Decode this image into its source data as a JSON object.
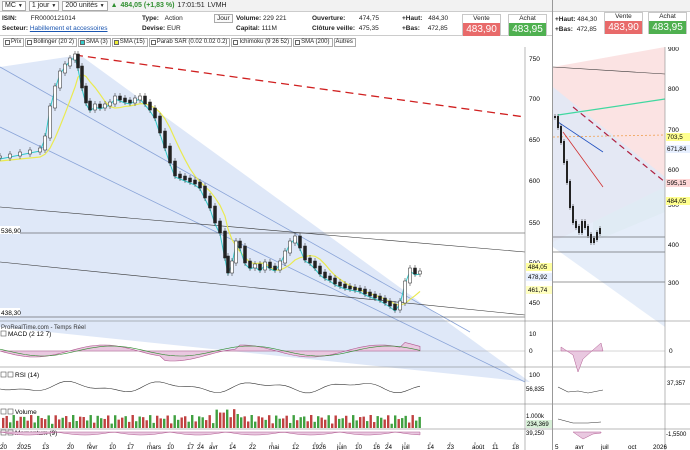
{
  "topbar": {
    "symbol": "MC",
    "period": "1 jour",
    "units": "200 unités",
    "quote": "484,05 (+1,83 %)",
    "time": "17:01:51",
    "name": "LVMH"
  },
  "info": {
    "isin_label": "ISIN:",
    "isin": "FR0000121014",
    "sector_label": "Secteur:",
    "sector": "Habillement et accessoires",
    "type_label": "Type:",
    "type": "Action",
    "currency_label": "Devise:",
    "currency": "EUR",
    "jour_button": "Jour",
    "volume_label": "Volume:",
    "volume": "229 221",
    "capital_label": "Capital:",
    "capital": "111M",
    "open_label": "Ouverture:",
    "open": "474,75",
    "prevclose_label": "Clôture veille:",
    "prevclose": "475,35",
    "high_label": "+Haut:",
    "high": "484,30",
    "low_label": "+Bas:",
    "low": "472,85"
  },
  "quotes": {
    "sell_label": "Vente",
    "sell": "483,90",
    "buy_label": "Achat",
    "buy": "483,95"
  },
  "toolbar": {
    "items": [
      {
        "label": "Prix"
      },
      {
        "label": "Bollinger (20 2)"
      },
      {
        "label": "SMA (3)"
      },
      {
        "label": "SMA (15)"
      },
      {
        "label": "Parab SAR (0.02 0.02 0.2)"
      },
      {
        "label": "Ichimoku (9 26 52)"
      },
      {
        "label": "SMA (200)"
      },
      {
        "label": "Autres"
      }
    ]
  },
  "main_chart": {
    "price_axis": [
      "750",
      "700",
      "650",
      "600",
      "550",
      "500",
      "450"
    ],
    "price_tags": [
      {
        "text": "484,05",
        "bg": "#ffffa0"
      },
      {
        "text": "478,92",
        "bg": "#e8f0ff"
      },
      {
        "text": "461,74",
        "bg": "#ffffc0"
      }
    ],
    "left_labels": [
      "536,90",
      "438,30"
    ],
    "watermark": "ProRealTime.com - Temps Réel",
    "x_labels": [
      "20",
      "2025",
      "13",
      "20",
      "févr",
      "10",
      "17",
      "mars",
      "10",
      "17",
      "24",
      "avr",
      "14",
      "22",
      "mai",
      "12",
      "19",
      "26",
      "juin",
      "10",
      "16",
      "24",
      "juil",
      "14",
      "23",
      "août",
      "11",
      "18"
    ]
  },
  "panels": {
    "macd": {
      "label": "MACD (2 12 7)",
      "axis": [
        "10",
        "0"
      ]
    },
    "rsi": {
      "label": "RSI (14)",
      "axis": [
        "100",
        "56,835"
      ]
    },
    "volume": {
      "label": "Volume",
      "axis": [
        "1.000k",
        "234,369"
      ]
    },
    "momentum": {
      "label": "Momentum (9)",
      "axis": [
        "39,250"
      ]
    }
  },
  "right_window": {
    "quotes": {
      "high_label": "+Haut:",
      "high": "484,30",
      "low_label": "+Bas:",
      "low": "472,85",
      "sell_label": "Vente",
      "sell": "483,90",
      "buy_label": "Achat",
      "buy": "483,95"
    },
    "price_axis": [
      "900",
      "800",
      "700",
      "600",
      "500",
      "400",
      "300"
    ],
    "tags": [
      {
        "text": "703,5",
        "bg": "#ffff90"
      },
      {
        "text": "671,84",
        "bg": "#e8f0ff"
      },
      {
        "text": "595,15",
        "bg": "#ffd8d8"
      },
      {
        "text": "484,05",
        "bg": "#ffff90"
      }
    ],
    "macd_axis": [
      "0"
    ],
    "rsi_axis": [
      "37,357"
    ],
    "mom_axis": [
      "-1,5500"
    ],
    "x_labels": [
      "5",
      "avr",
      "juil",
      "oct",
      "2026"
    ]
  }
}
